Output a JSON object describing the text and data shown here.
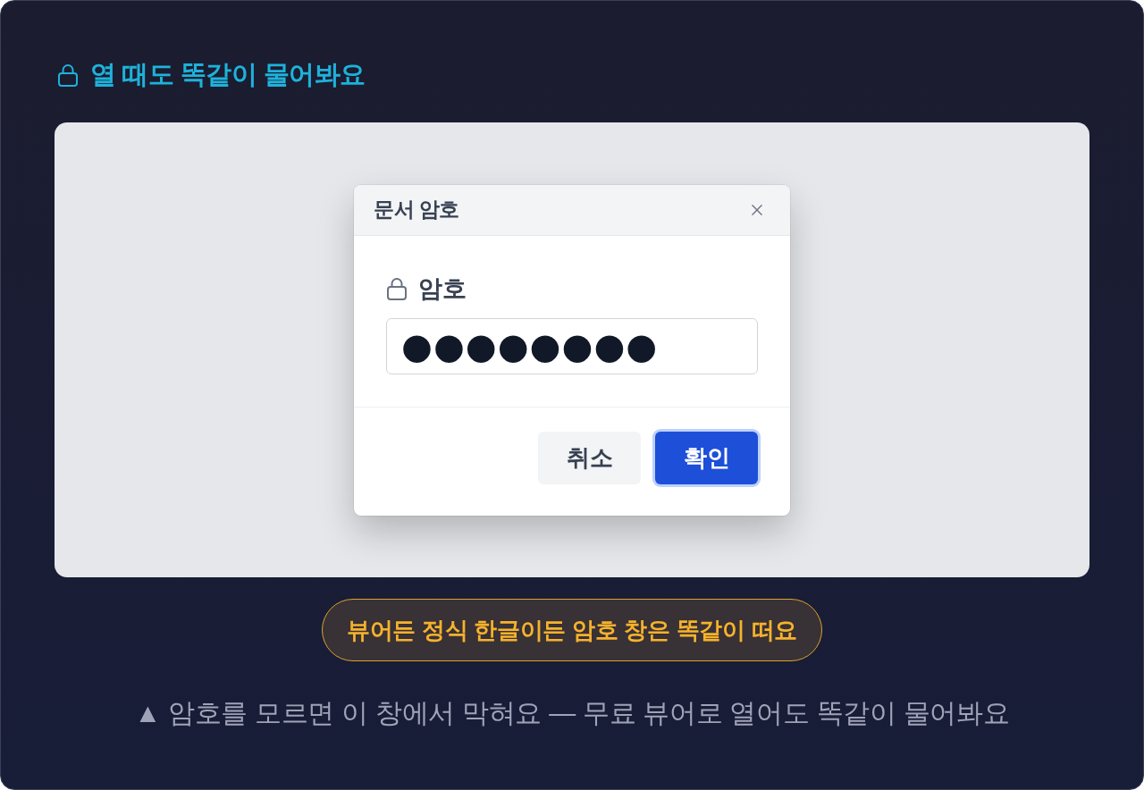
{
  "heading": {
    "text": "열 때도 똑같이 물어봐요"
  },
  "dialog": {
    "title": "문서 암호",
    "field": {
      "label": "암호",
      "value": "●●●●●●●●"
    },
    "buttons": [
      {
        "label": "취소",
        "kind": "secondary",
        "focused": false
      },
      {
        "label": "확인",
        "kind": "primary",
        "focused": true
      }
    ]
  },
  "callout": {
    "text": "뷰어든 정식 한글이든 암호 창은 똑같이 떠요"
  },
  "caption": {
    "text": "▲ 암호를 모르면 이 창에서 막혀요 — 무료 뷰어로 열어도 똑같이 물어봐요"
  }
}
